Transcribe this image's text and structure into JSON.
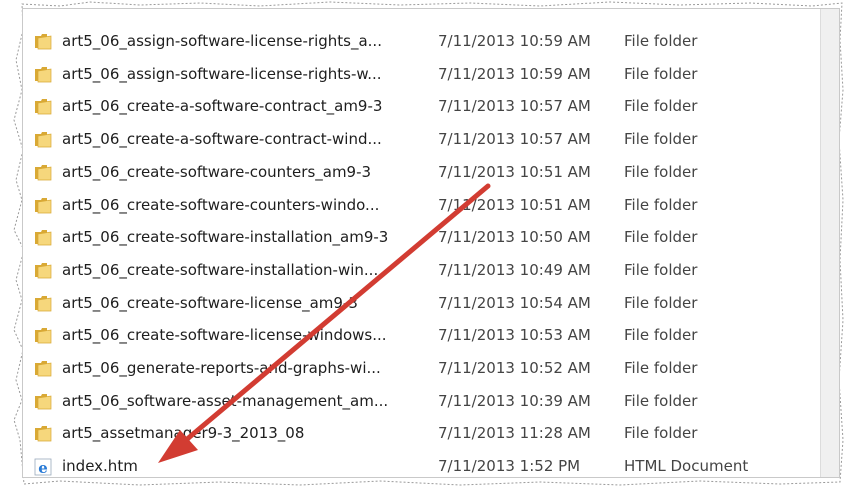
{
  "files": [
    {
      "name": "art5_06_assign-software-license-rights_a...",
      "date": "7/11/2013 10:59 AM",
      "type": "File folder",
      "icon": "folder-icon"
    },
    {
      "name": "art5_06_assign-software-license-rights-w...",
      "date": "7/11/2013 10:59 AM",
      "type": "File folder",
      "icon": "folder-icon"
    },
    {
      "name": "art5_06_create-a-software-contract_am9-3",
      "date": "7/11/2013 10:57 AM",
      "type": "File folder",
      "icon": "folder-icon"
    },
    {
      "name": "art5_06_create-a-software-contract-wind...",
      "date": "7/11/2013 10:57 AM",
      "type": "File folder",
      "icon": "folder-icon"
    },
    {
      "name": "art5_06_create-software-counters_am9-3",
      "date": "7/11/2013 10:51 AM",
      "type": "File folder",
      "icon": "folder-icon"
    },
    {
      "name": "art5_06_create-software-counters-windo...",
      "date": "7/11/2013 10:51 AM",
      "type": "File folder",
      "icon": "folder-icon"
    },
    {
      "name": "art5_06_create-software-installation_am9-3",
      "date": "7/11/2013 10:50 AM",
      "type": "File folder",
      "icon": "folder-icon"
    },
    {
      "name": "art5_06_create-software-installation-win...",
      "date": "7/11/2013 10:49 AM",
      "type": "File folder",
      "icon": "folder-icon"
    },
    {
      "name": "art5_06_create-software-license_am9-3",
      "date": "7/11/2013 10:54 AM",
      "type": "File folder",
      "icon": "folder-icon"
    },
    {
      "name": "art5_06_create-software-license-windows...",
      "date": "7/11/2013 10:53 AM",
      "type": "File folder",
      "icon": "folder-icon"
    },
    {
      "name": "art5_06_generate-reports-and-graphs-wi...",
      "date": "7/11/2013 10:52 AM",
      "type": "File folder",
      "icon": "folder-icon"
    },
    {
      "name": "art5_06_software-asset-management_am...",
      "date": "7/11/2013 10:39 AM",
      "type": "File folder",
      "icon": "folder-icon"
    },
    {
      "name": "art5_assetmanager9-3_2013_08",
      "date": "7/11/2013 11:28 AM",
      "type": "File folder",
      "icon": "folder-icon"
    },
    {
      "name": "index.htm",
      "date": "7/11/2013 1:52 PM",
      "type": "HTML Document",
      "icon": "ie-html-icon"
    }
  ],
  "colors": {
    "folder_light": "#f6d77c",
    "folder_dark": "#d9a935",
    "arrow": "#d23c32",
    "ie_blue": "#2a7bd6"
  }
}
